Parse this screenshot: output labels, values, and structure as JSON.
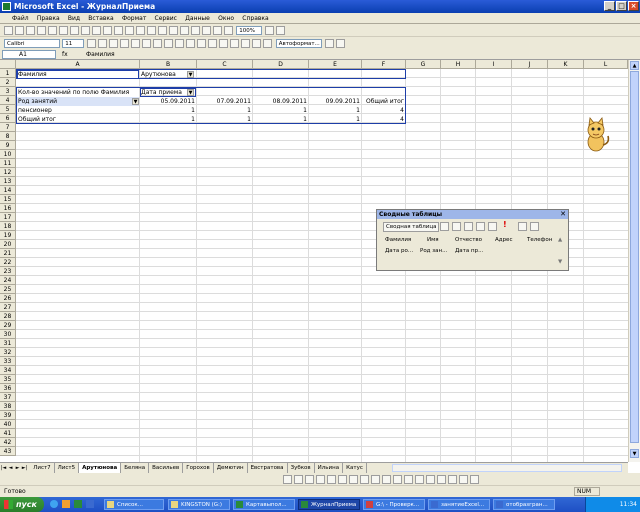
{
  "window": {
    "title": "Microsoft Excel - ЖурналПриема"
  },
  "menu": [
    "Файл",
    "Правка",
    "Вид",
    "Вставка",
    "Формат",
    "Сервис",
    "Данные",
    "Окно",
    "Справка"
  ],
  "toolbar": {
    "zoom": "100%",
    "font": "Calibri",
    "size": "11",
    "autoformat": "Автоформат..."
  },
  "formula": {
    "cell": "A1",
    "fx": "fx",
    "value": "Фамилия"
  },
  "columns": [
    "A",
    "B",
    "C",
    "D",
    "E",
    "F",
    "G",
    "H",
    "I",
    "J",
    "K",
    "L"
  ],
  "rows": [
    "1",
    "2",
    "3",
    "4",
    "5",
    "6",
    "7",
    "8",
    "9",
    "10",
    "11",
    "12",
    "13",
    "14",
    "15",
    "16",
    "17",
    "18",
    "19",
    "20",
    "21",
    "22",
    "23",
    "24",
    "25",
    "26",
    "27",
    "28",
    "29",
    "30",
    "31",
    "32",
    "33",
    "34",
    "35",
    "36",
    "37",
    "38",
    "39",
    "40",
    "41",
    "42",
    "43"
  ],
  "cells": {
    "a1": "Фамилия",
    "b1": "Арутюнова",
    "a3": "Кол-во значений по полю Фамилия",
    "b3": "Дата приема",
    "a4": "Род занятий",
    "b4": "05.09.2011",
    "c4": "07.09.2011",
    "d4": "08.09.2011",
    "e4": "09.09.2011",
    "f4": "Общий итог",
    "a5": "пенсионер",
    "b5": "1",
    "c5": "1",
    "d5": "1",
    "e5": "1",
    "f5": "4",
    "a6": "Общий итог",
    "b6": "1",
    "c6": "1",
    "d6": "1",
    "e6": "1",
    "f6": "4"
  },
  "pivot_toolbar": {
    "title": "Сводные таблицы",
    "menu": "Сводная таблица",
    "fields": [
      "Фамилия",
      "Имя",
      "Отчество",
      "Адрес",
      "Телефон",
      "Дата ро...",
      "Род зан...",
      "Дата пр..."
    ]
  },
  "sheet_tabs": [
    "Лист7",
    "Лист5",
    "Арутюнова",
    "Беляна",
    "Васильев",
    "Горохов",
    "Демютин",
    "Евстратова",
    "Зубков",
    "Ильина",
    "Катус"
  ],
  "active_tab": "Арутюнова",
  "status": {
    "text": "Готово",
    "num": "NUM"
  },
  "taskbar": {
    "start": "пуск",
    "items": [
      "Список...",
      "KINGSTON (G:)",
      "Картавыпол...",
      "ЖурналПриема",
      "G:\\ - Проверк...",
      "занятиеExcel...",
      "отобразгран..."
    ],
    "time": "11:34"
  }
}
